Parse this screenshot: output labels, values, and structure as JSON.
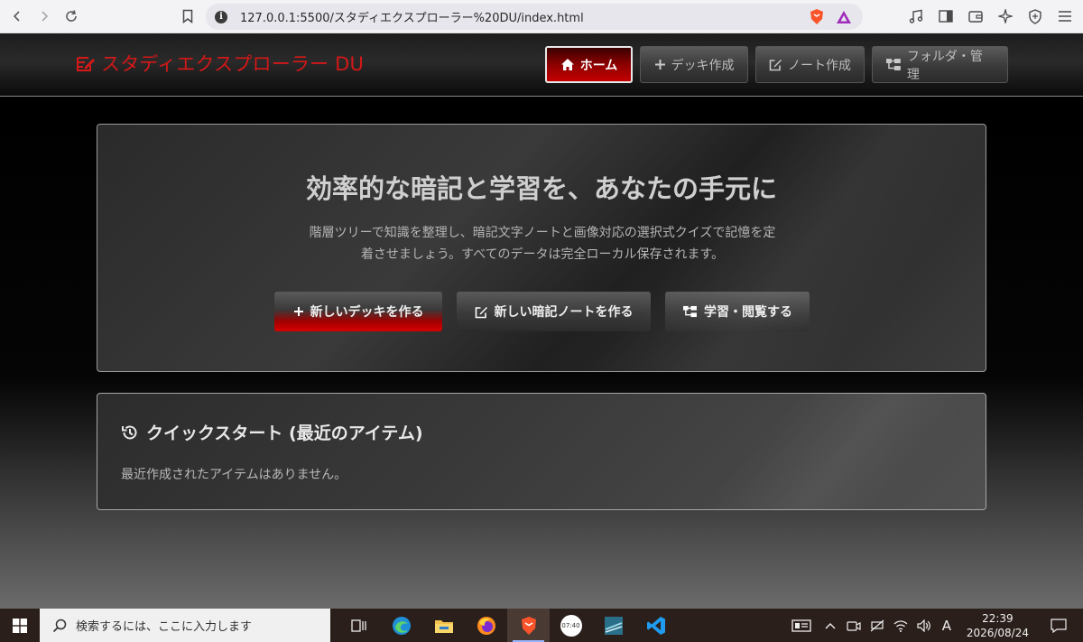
{
  "browser": {
    "url": "127.0.0.1:5500/スタディエクスプローラー%20DU/index.html"
  },
  "app": {
    "brand": "スタディエクスプローラー DU",
    "nav": [
      {
        "label": "ホーム",
        "icon": "home-icon",
        "active": true
      },
      {
        "label": "デッキ作成",
        "icon": "plus-icon",
        "active": false
      },
      {
        "label": "ノート作成",
        "icon": "edit-icon",
        "active": false
      },
      {
        "label": "フォルダ・管理",
        "icon": "folder-tree-icon",
        "active": false
      }
    ]
  },
  "hero": {
    "title": "効率的な暗記と学習を、あなたの手元に",
    "description_line1": "階層ツリーで知識を整理し、暗記文字ノートと画像対応の選択式クイズで記憶を定",
    "description_line2": "着させましょう。すべてのデータは完全ローカル保存されます。",
    "buttons": {
      "new_deck": "新しいデッキを作る",
      "new_note": "新しい暗記ノートを作る",
      "browse": "学習・閲覧する"
    }
  },
  "quick_start": {
    "title": "クイックスタート (最近のアイテム)",
    "empty_message": "最近作成されたアイテムはありません。"
  },
  "taskbar": {
    "search_placeholder": "検索するには、ここに入力します",
    "time": "22:39",
    "date": "2026/08/24",
    "ime": "A",
    "clock_badge": "07:40"
  },
  "colors": {
    "brand_red": "#d41818",
    "active_red": "#c40000"
  }
}
